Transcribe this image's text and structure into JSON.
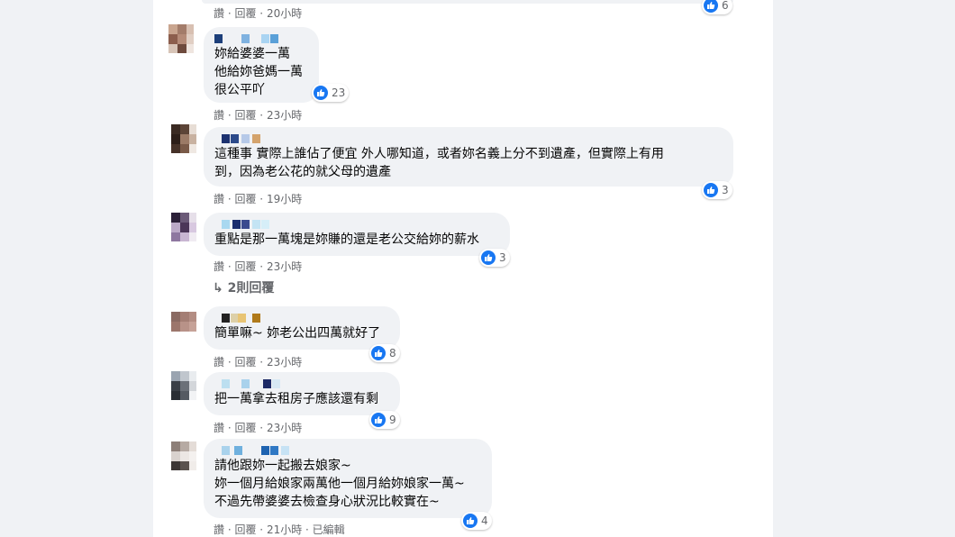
{
  "meta_like": "讚",
  "meta_reply": "回覆",
  "comments": [
    {
      "text": "",
      "time": "20小時",
      "reactions": "6"
    },
    {
      "text": "妳給婆婆一萬\n他給妳爸媽一萬\n很公平吖",
      "time": "23小時",
      "reactions": "23"
    },
    {
      "text": "這種事 實際上誰佔了便宜 外人哪知道，或者妳名義上分不到遺產，但實際上有用\n到，因為老公花的就父母的遺產",
      "time": "19小時",
      "reactions": "3"
    },
    {
      "text": "重點是那一萬塊是妳賺的還是老公交給妳的薪水",
      "time": "23小時",
      "reactions": "3",
      "replies": "2則回覆"
    },
    {
      "text": "簡單嘛~ 妳老公出四萬就好了",
      "time": "23小時",
      "reactions": "8"
    },
    {
      "text": "把一萬拿去租房子應該還有剩",
      "time": "23小時",
      "reactions": "9"
    },
    {
      "text": "請他跟妳一起搬去娘家~\n妳一個月給娘家兩萬他一個月給妳娘家一萬~\n不過先帶婆婆去檢查身心狀況比較實在~",
      "time": "21小時",
      "reactions": "4",
      "edited": "已編輯"
    }
  ],
  "colors": {
    "like_blue": "#1877f2",
    "bubble": "#f0f2f5",
    "meta": "#65676b"
  },
  "icons": {
    "like": "thumbs-up-icon",
    "reply_arrow": "reply-arrow-icon"
  }
}
